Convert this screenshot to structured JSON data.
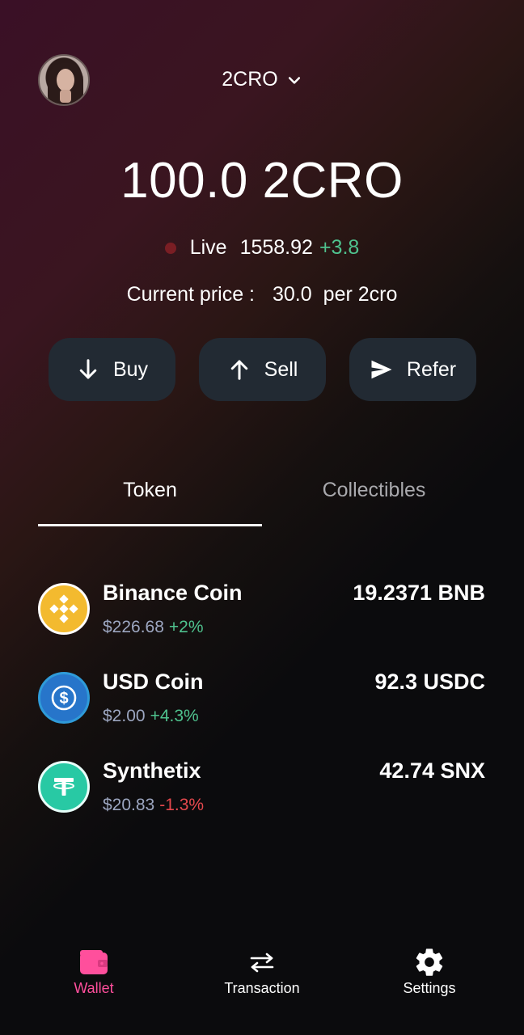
{
  "header": {
    "network": "2CRO"
  },
  "balance": {
    "amount": "100.0 2CRO"
  },
  "live": {
    "label": "Live",
    "value": "1558.92",
    "change": "+3.8"
  },
  "price": {
    "label": "Current price :",
    "value": "30.0",
    "unit": "per 2cro"
  },
  "actions": [
    {
      "label": "Buy",
      "icon": "arrow-down-icon"
    },
    {
      "label": "Sell",
      "icon": "arrow-up-icon"
    },
    {
      "label": "Refer",
      "icon": "send-icon"
    }
  ],
  "tabs": [
    {
      "label": "Token",
      "active": true
    },
    {
      "label": "Collectibles",
      "active": false
    }
  ],
  "tokens": [
    {
      "name": "Binance Coin",
      "usd": "$226.68",
      "change": "+2%",
      "amount": "19.2371 BNB",
      "icon": "bnb-icon",
      "color": "#f3ba2f"
    },
    {
      "name": "USD Coin",
      "usd": "$2.00",
      "change": "+4.3%",
      "amount": "92.3 USDC",
      "icon": "usdc-icon",
      "color": "#2775ca"
    },
    {
      "name": "Synthetix",
      "usd": "$20.83",
      "change": "-1.3%",
      "amount": "42.74 SNX",
      "icon": "tether-icon",
      "color": "#28c9a4"
    }
  ],
  "nav": [
    {
      "label": "Wallet",
      "icon": "wallet-icon",
      "active": true
    },
    {
      "label": "Transaction",
      "icon": "swap-arrows-icon",
      "active": false
    },
    {
      "label": "Settings",
      "icon": "gear-icon",
      "active": false
    }
  ],
  "colors": {
    "positive": "#4fc28e",
    "negative": "#e5484d",
    "accent": "#ff4f9c",
    "button_bg": "#222a33"
  }
}
